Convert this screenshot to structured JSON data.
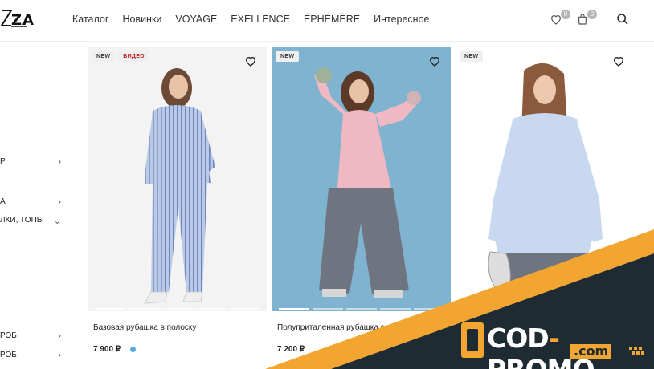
{
  "header": {
    "logo": "ZA",
    "nav": [
      "Каталог",
      "Новинки",
      "VOYAGE",
      "EXELLENCE",
      "ÉPHÉMÈRE",
      "Интересное"
    ],
    "wishlist_count": "0",
    "cart_count": "0"
  },
  "sidebar": {
    "items": [
      {
        "label": "Р",
        "chevron": "›"
      },
      {
        "label": "А",
        "chevron": "›"
      },
      {
        "label": "ЛКИ, ТОПЫ",
        "chevron": "⌄"
      },
      {
        "label": "РОБ",
        "chevron": "›"
      },
      {
        "label": "РОБ",
        "chevron": "›"
      }
    ]
  },
  "products": [
    {
      "tags": [
        "NEW",
        "ВИДЕО"
      ],
      "name": "Базовая рубашка в полоску",
      "price": "7 900 ₽",
      "swatch": "#5aa6e8"
    },
    {
      "tags": [
        "NEW"
      ],
      "name": "Полуприталенная рубашка с воротником",
      "price": "7 200 ₽",
      "swatch": ""
    },
    {
      "tags": [
        "NEW"
      ],
      "name": "",
      "price": "",
      "swatch": ""
    }
  ],
  "promo": {
    "main": "COD",
    "dash": "-",
    "suffix": "PROMO",
    "domain": ".com"
  },
  "colors": {
    "accent": "#f2a531",
    "banner": "#1f2b33",
    "card_bg_2": "#7fb3cf"
  }
}
